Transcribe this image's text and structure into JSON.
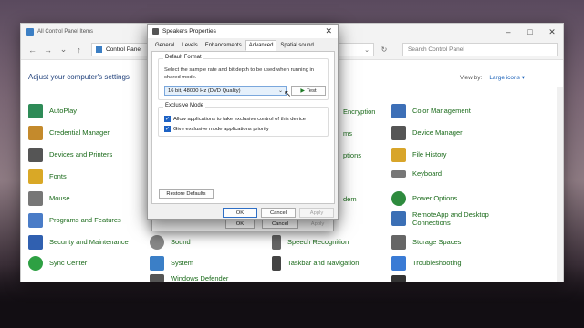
{
  "control_panel": {
    "window_title": "All Control Panel Items",
    "address": "Control Panel",
    "search_placeholder": "Search Control Panel",
    "heading": "Adjust your computer's settings",
    "view_by_label": "View by:",
    "view_by_value": "Large icons ▾",
    "nav_back": "←",
    "nav_forward": "→",
    "nav_down": "⌄",
    "nav_up": "↑",
    "refresh": "↻",
    "minimize": "–",
    "maximize": "□",
    "close": "✕",
    "items": [
      {
        "label": "AutoPlay",
        "icon": "autoplay-icon",
        "color": "#2e8b57"
      },
      {
        "label": "Credential Manager",
        "icon": "credential-icon",
        "color": "#c48a2c"
      },
      {
        "label": "Devices and Printers",
        "icon": "printer-icon",
        "color": "#555555"
      },
      {
        "label": "Fonts",
        "icon": "font-icon",
        "color": "#d9a826"
      },
      {
        "label": "Mouse",
        "icon": "mouse-icon",
        "color": "#777777"
      },
      {
        "label": "Programs and Features",
        "icon": "programs-icon",
        "color": "#4a7cc7"
      },
      {
        "label": "Security and Maintenance",
        "icon": "flag-icon",
        "color": "#3060b0"
      },
      {
        "label": "Sync Center",
        "icon": "sync-icon",
        "color": "#2ea043"
      },
      {
        "label": "Sound",
        "icon": "speaker-icon",
        "color": "#888888"
      },
      {
        "label": "System",
        "icon": "system-icon",
        "color": "#3b7fc7"
      },
      {
        "label": "Windows Defender",
        "icon": "defender-icon",
        "color": "#555555"
      },
      {
        "label": "Encryption",
        "icon": "encryption-icon",
        "color": "#888888"
      },
      {
        "label": "ms",
        "icon": "generic-icon",
        "color": "#888888"
      },
      {
        "label": "ptions",
        "icon": "generic-icon",
        "color": "#888888"
      },
      {
        "label": "dem",
        "icon": "generic-icon",
        "color": "#888888"
      },
      {
        "label": "Speech Recognition",
        "icon": "microphone-icon",
        "color": "#666666"
      },
      {
        "label": "Taskbar and Navigation",
        "icon": "taskbar-icon",
        "color": "#444444"
      },
      {
        "label": "Color Management",
        "icon": "color-management-icon",
        "color": "#3d6fb7"
      },
      {
        "label": "Device Manager",
        "icon": "device-manager-icon",
        "color": "#555555"
      },
      {
        "label": "File History",
        "icon": "file-history-icon",
        "color": "#d8a52a"
      },
      {
        "label": "Keyboard",
        "icon": "keyboard-icon",
        "color": "#777777"
      },
      {
        "label": "Power Options",
        "icon": "power-icon",
        "color": "#2e8b3e"
      },
      {
        "label": "RemoteApp and Desktop Connections",
        "icon": "remoteapp-icon",
        "color": "#3b6fb5"
      },
      {
        "label": "Storage Spaces",
        "icon": "storage-icon",
        "color": "#666666"
      },
      {
        "label": "Troubleshooting",
        "icon": "troubleshooting-icon",
        "color": "#3a7bd5"
      },
      {
        "label": "",
        "icon": "windows-tools-icon",
        "color": "#333333"
      }
    ]
  },
  "back_dialog": {
    "ok": "OK",
    "cancel": "Cancel",
    "apply": "Apply"
  },
  "dialog": {
    "title": "Speakers Properties",
    "close": "✕",
    "tabs": [
      "General",
      "Levels",
      "Enhancements",
      "Advanced",
      "Spatial sound"
    ],
    "active_tab": "Advanced",
    "default_format": {
      "legend": "Default Format",
      "description": "Select the sample rate and bit depth to be used when running in shared mode.",
      "selected": "16 bit, 48000 Hz (DVD Quality)",
      "dropdown_arrow": "⌄",
      "test_label": "Test",
      "test_icon": "▶"
    },
    "exclusive_mode": {
      "legend": "Exclusive Mode",
      "options": [
        {
          "label": "Allow applications to take exclusive control of this device",
          "checked": true
        },
        {
          "label": "Give exclusive mode applications priority",
          "checked": true
        }
      ],
      "check_glyph": "✓"
    },
    "restore_defaults": "Restore Defaults",
    "ok": "OK",
    "cancel": "Cancel",
    "apply": "Apply"
  }
}
